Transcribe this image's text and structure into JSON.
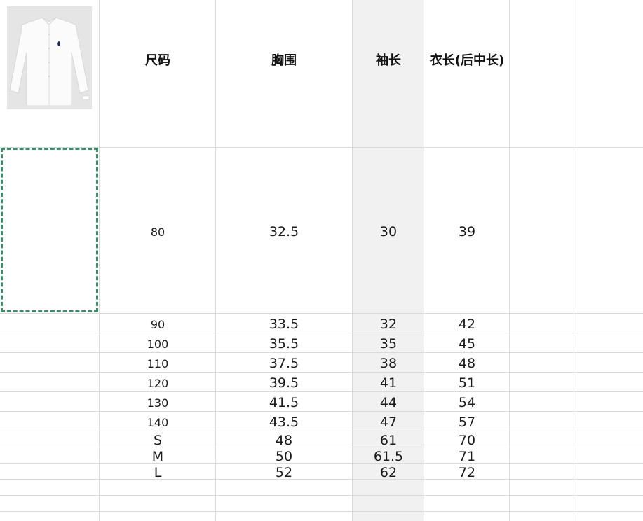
{
  "headers": {
    "size": "尺码",
    "chest": "胸围",
    "sleeve": "袖长",
    "length": "衣长(后中长)"
  },
  "rows": [
    {
      "size": "80",
      "chest": "32.5",
      "sleeve": "30",
      "length": "39"
    },
    {
      "size": "90",
      "chest": "33.5",
      "sleeve": "32",
      "length": "42"
    },
    {
      "size": "100",
      "chest": "35.5",
      "sleeve": "35",
      "length": "45"
    },
    {
      "size": "110",
      "chest": "37.5",
      "sleeve": "38",
      "length": "48"
    },
    {
      "size": "120",
      "chest": "39.5",
      "sleeve": "41",
      "length": "51"
    },
    {
      "size": "130",
      "chest": "41.5",
      "sleeve": "44",
      "length": "54"
    },
    {
      "size": "140",
      "chest": "43.5",
      "sleeve": "47",
      "length": "57"
    },
    {
      "size": "S",
      "chest": "48",
      "sleeve": "61",
      "length": "70"
    },
    {
      "size": "M",
      "chest": "50",
      "sleeve": "61.5",
      "length": "71"
    },
    {
      "size": "L",
      "chest": "52",
      "sleeve": "62",
      "length": "72"
    }
  ],
  "image": {
    "icon": "shirt-product-image",
    "colors": {
      "background": "#e5e5e5",
      "shirt": "#fbfbfb",
      "logo": "#1f2a5a"
    }
  },
  "colors": {
    "gridline": "#dadada",
    "selection_border": "#3f8a68",
    "column_shade": "#f1f1f1"
  }
}
